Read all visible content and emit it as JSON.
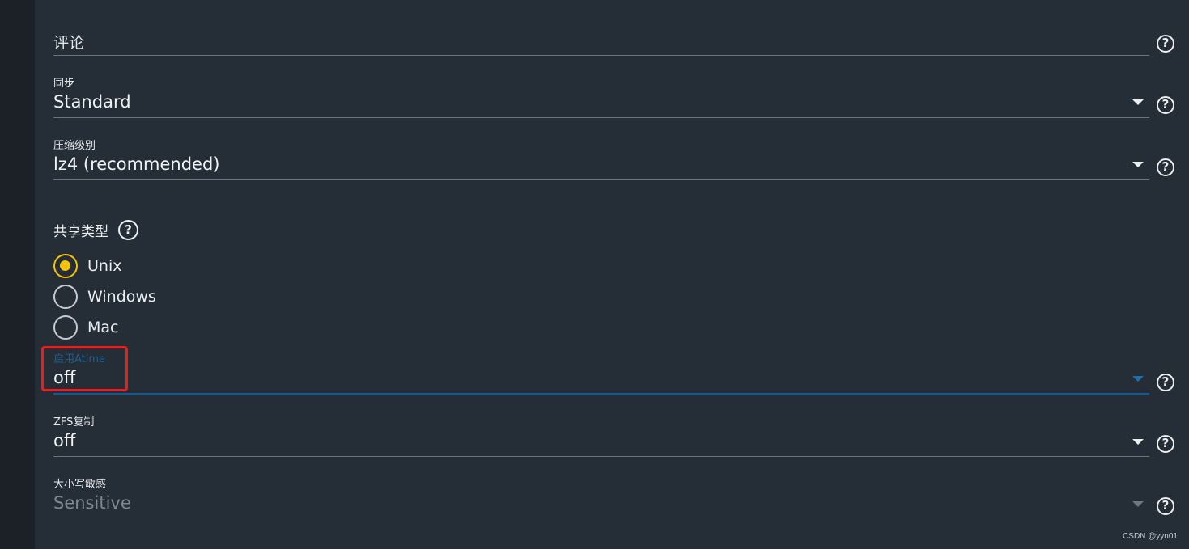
{
  "fields": {
    "comment": {
      "label": "评论"
    },
    "sync": {
      "label": "同步",
      "value": "Standard"
    },
    "compression": {
      "label": "压缩级别",
      "value": "lz4 (recommended)"
    },
    "atime": {
      "label": "启用Atime",
      "value": "off"
    },
    "zfs_dedup": {
      "label": "ZFS复制",
      "value": "off"
    },
    "case_sensitivity": {
      "label": "大小写敏感",
      "value": "Sensitive"
    }
  },
  "share_type": {
    "label": "共享类型",
    "options": [
      {
        "label": "Unix",
        "checked": true
      },
      {
        "label": "Windows",
        "checked": false
      },
      {
        "label": "Mac",
        "checked": false
      }
    ]
  },
  "help_glyph": "?",
  "watermark": "CSDN @yyn01",
  "colors": {
    "background": "#252d37",
    "accent": "#f5c400",
    "focus": "#0d5b96",
    "highlight": "#ee1c1c"
  }
}
